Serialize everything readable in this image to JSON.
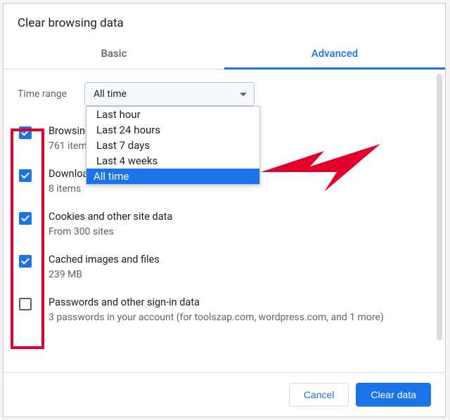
{
  "dialog": {
    "title": "Clear browsing data",
    "tabs": {
      "basic": "Basic",
      "advanced": "Advanced"
    }
  },
  "time_range": {
    "label": "Time range",
    "value": "All time",
    "options": [
      "Last hour",
      "Last 24 hours",
      "Last 7 days",
      "Last 4 weeks",
      "All time"
    ]
  },
  "items": [
    {
      "title": "Browsing history",
      "sub": "761 items",
      "checked": true
    },
    {
      "title": "Download history",
      "sub": "8 items",
      "checked": true
    },
    {
      "title": "Cookies and other site data",
      "sub": "From 300 sites",
      "checked": true
    },
    {
      "title": "Cached images and files",
      "sub": "239 MB",
      "checked": true
    },
    {
      "title": "Passwords and other sign-in data",
      "sub": "3 passwords in your account (for toolszap.com, wordpress.com, and 1 more)",
      "checked": false
    }
  ],
  "footer": {
    "cancel": "Cancel",
    "clear": "Clear data"
  }
}
